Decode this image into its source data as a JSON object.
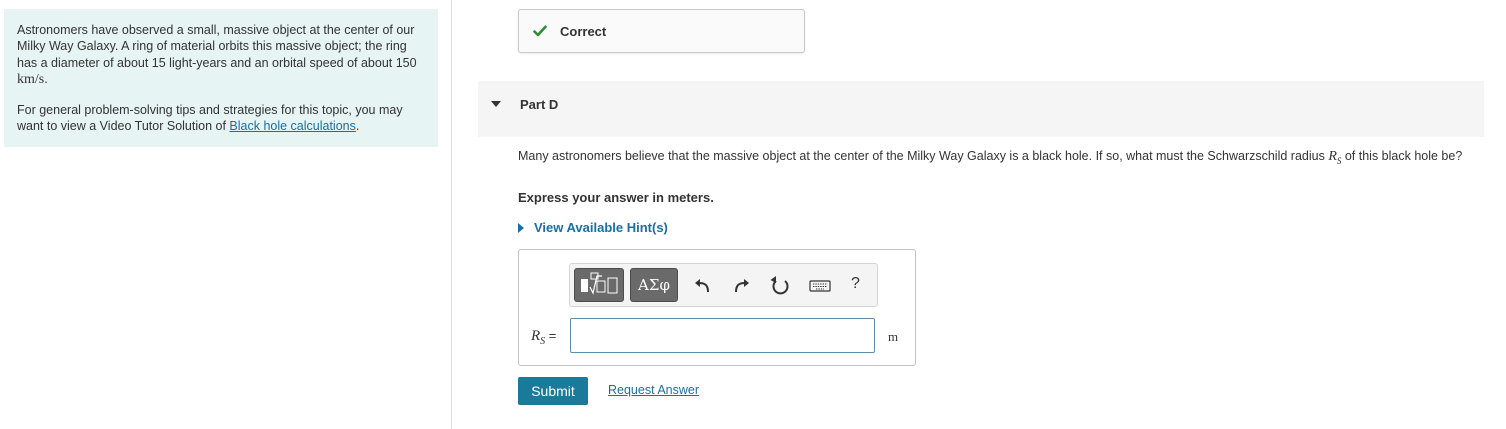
{
  "intro": {
    "text_1": "Astronomers have observed a small, massive object at the center of our Milky Way Galaxy. A ring of material orbits this massive object; the ring has a diameter of about 15 light-years and an orbital speed of about 150 ",
    "speed_unit": "km/s",
    "text_1_end": ".",
    "text_2": "For general problem-solving tips and strategies for this topic, you may want to view a Video Tutor Solution of ",
    "link_text": "Black hole calculations",
    "text_2_end": "."
  },
  "feedback": {
    "label": "Correct",
    "color": "#2e8b3a"
  },
  "part": {
    "title": "Part D",
    "question_pre": "Many astronomers believe that the massive object at the center of the Milky Way Galaxy is a black hole. If so, what must the Schwarzschild radius ",
    "symbol": "R",
    "symbol_sub": "S",
    "question_post": " of this black hole be?",
    "instruction": "Express your answer in meters.",
    "hints_label": "View Available Hint(s)"
  },
  "answer": {
    "label_symbol": "R",
    "label_sub": "S",
    "equals": " =",
    "value": "",
    "unit": "m"
  },
  "toolbar": {
    "greek_label": "ΑΣφ",
    "help_label": "?"
  },
  "actions": {
    "submit_label": "Submit",
    "request_label": "Request Answer"
  },
  "colors": {
    "accent": "#1a7a9a",
    "link": "#1a6fa0",
    "panel_bg": "#e6f4f3"
  }
}
